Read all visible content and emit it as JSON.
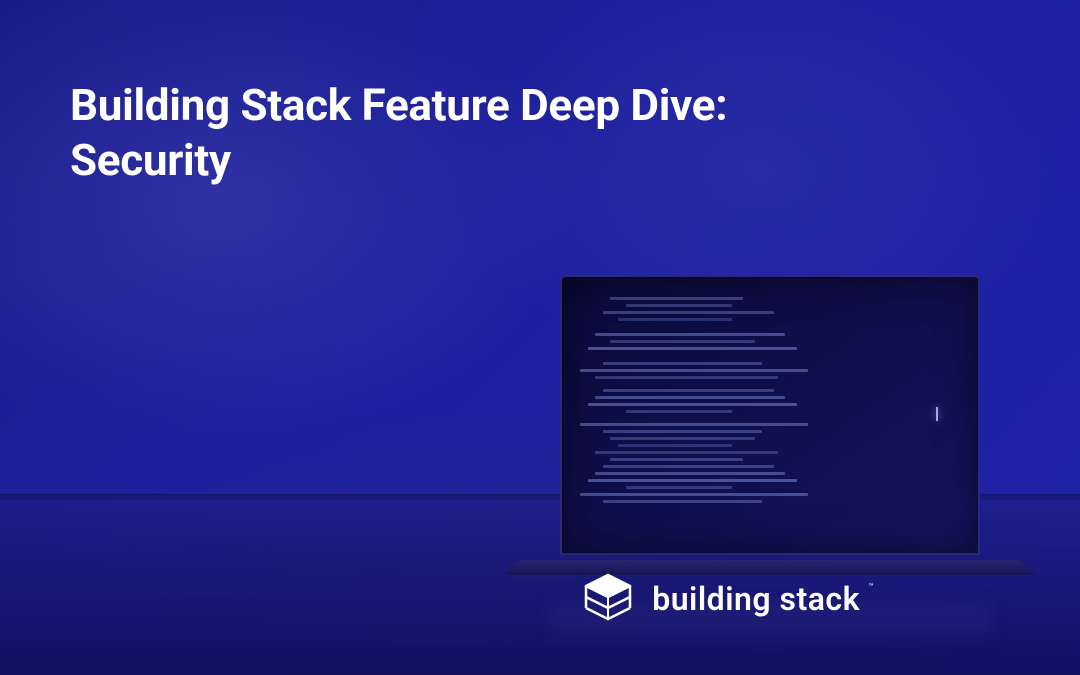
{
  "headline": {
    "line1": "Building Stack Feature Deep Dive:",
    "line2": "Security"
  },
  "logo": {
    "brand_name": "building stack",
    "trademark": "™"
  },
  "colors": {
    "background_primary": "#1e1f9e",
    "text_primary": "#ffffff"
  }
}
